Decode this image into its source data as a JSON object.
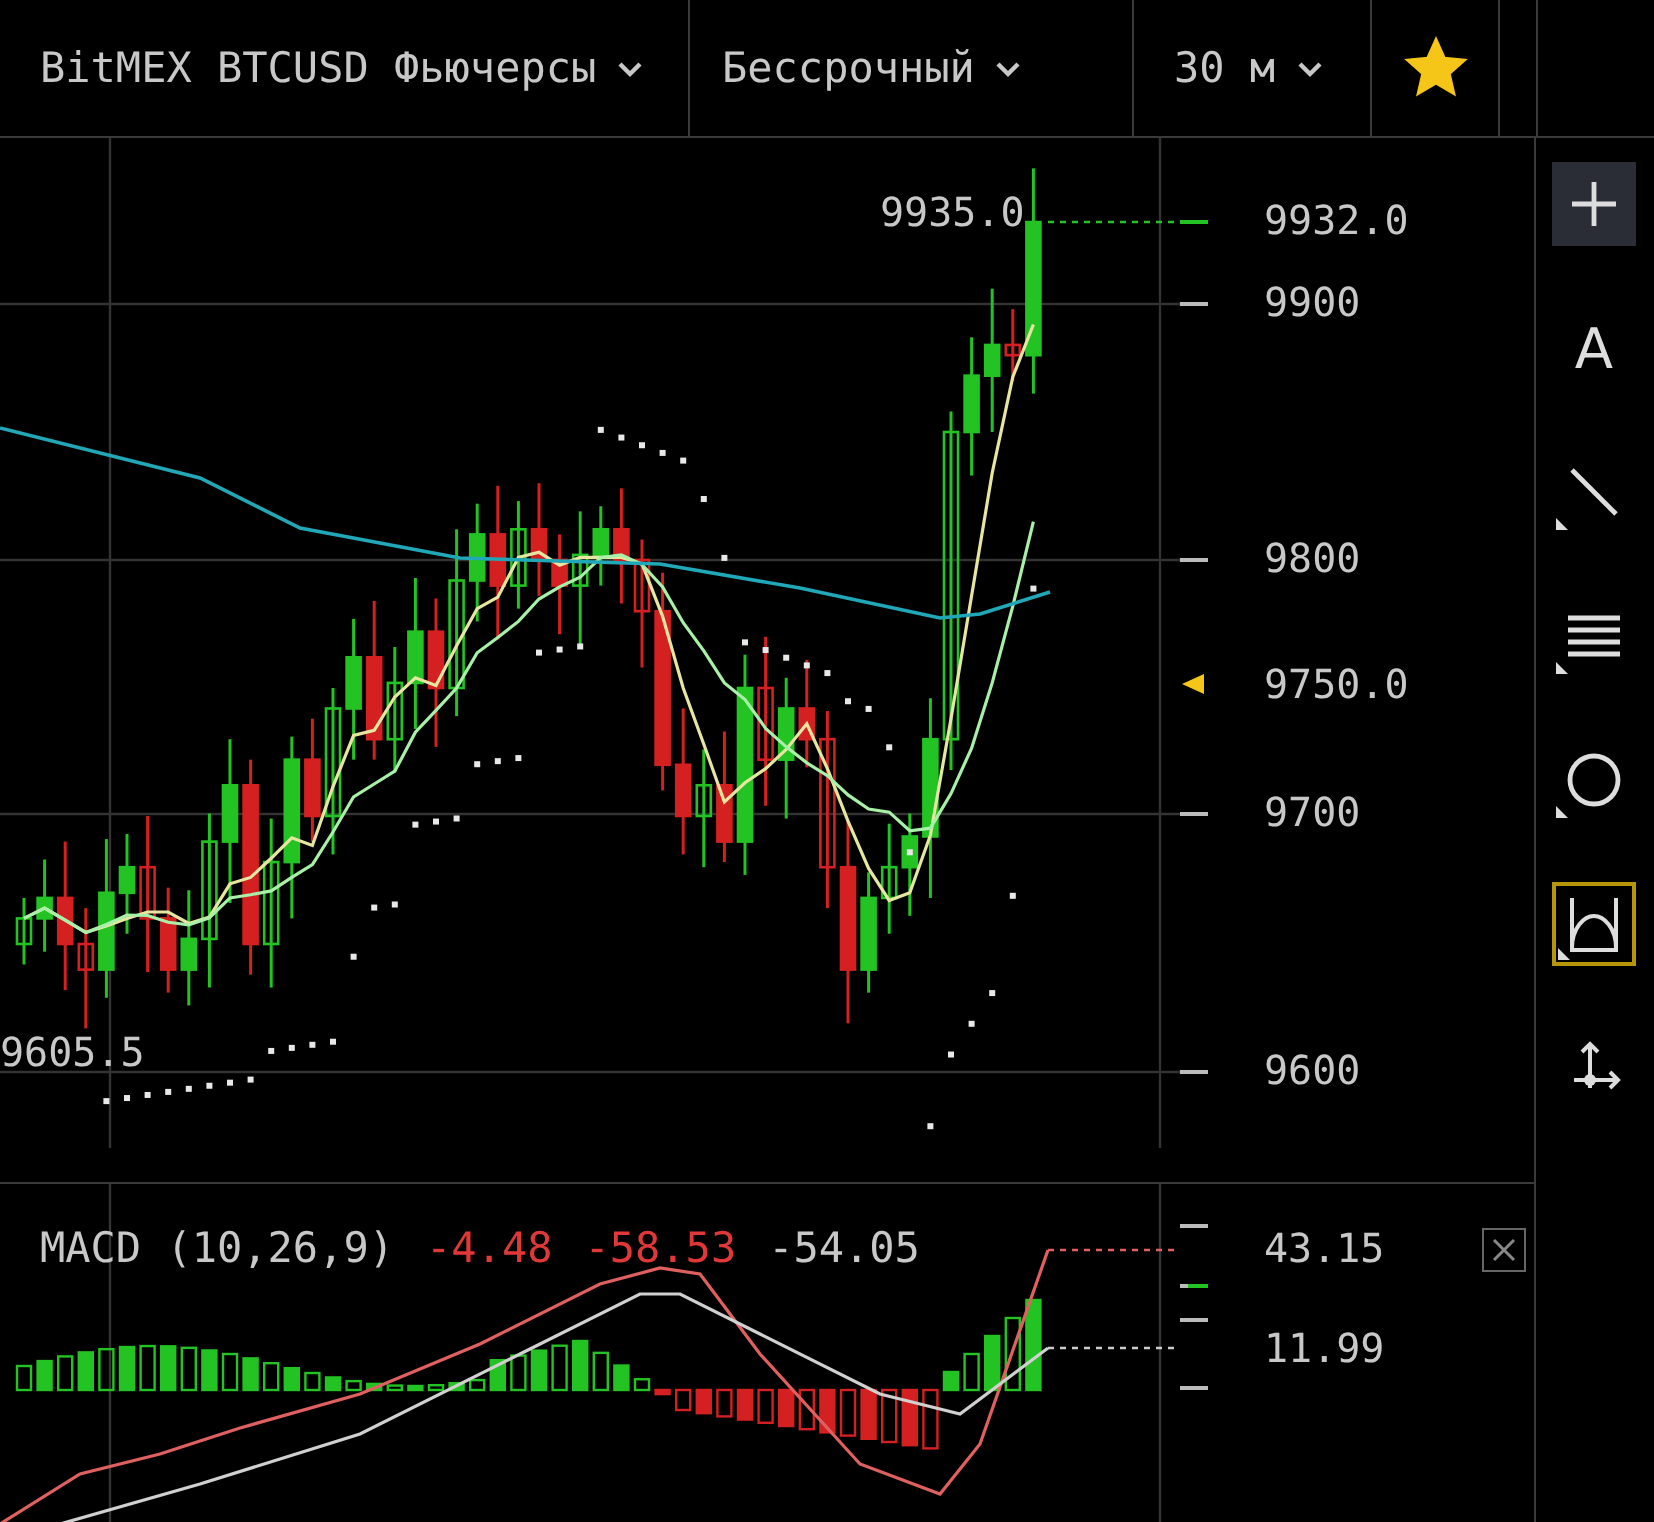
{
  "header": {
    "selectors": [
      {
        "label": "BitMEX BTCUSD Фьючерсы"
      },
      {
        "label": "Бессрочный"
      },
      {
        "label": "30 м"
      }
    ],
    "favorite": true
  },
  "price_chart": {
    "high_label": "9935.0",
    "low_label": "9605.5",
    "axis_labels": [
      {
        "text": "9932.0",
        "kind": "current"
      },
      {
        "text": "9900",
        "kind": "tick"
      },
      {
        "text": "9800",
        "kind": "tick"
      },
      {
        "text": "9750.0",
        "kind": "marker"
      },
      {
        "text": "9700",
        "kind": "tick"
      },
      {
        "text": "9600",
        "kind": "tick"
      }
    ]
  },
  "macd": {
    "title": "MACD (10,26,9)",
    "values": [
      {
        "text": "-4.48",
        "color": "#e03838"
      },
      {
        "text": "-58.53",
        "color": "#e03838"
      },
      {
        "text": "-54.05",
        "color": "#c8c8c8"
      }
    ],
    "axis_labels": [
      {
        "text": "43.15"
      },
      {
        "text": "11.99"
      }
    ]
  },
  "tools": [
    {
      "kind": "crosshair",
      "selected": true,
      "highlighted": false,
      "submenu": false
    },
    {
      "kind": "text",
      "label": "A",
      "selected": false,
      "highlighted": false,
      "submenu": false
    },
    {
      "kind": "line",
      "selected": false,
      "highlighted": false,
      "submenu": true
    },
    {
      "kind": "lines",
      "selected": false,
      "highlighted": false,
      "submenu": true
    },
    {
      "kind": "circle",
      "selected": false,
      "highlighted": false,
      "submenu": true
    },
    {
      "kind": "measure",
      "selected": false,
      "highlighted": true,
      "submenu": true
    },
    {
      "kind": "move",
      "selected": false,
      "highlighted": false,
      "submenu": false
    }
  ]
}
